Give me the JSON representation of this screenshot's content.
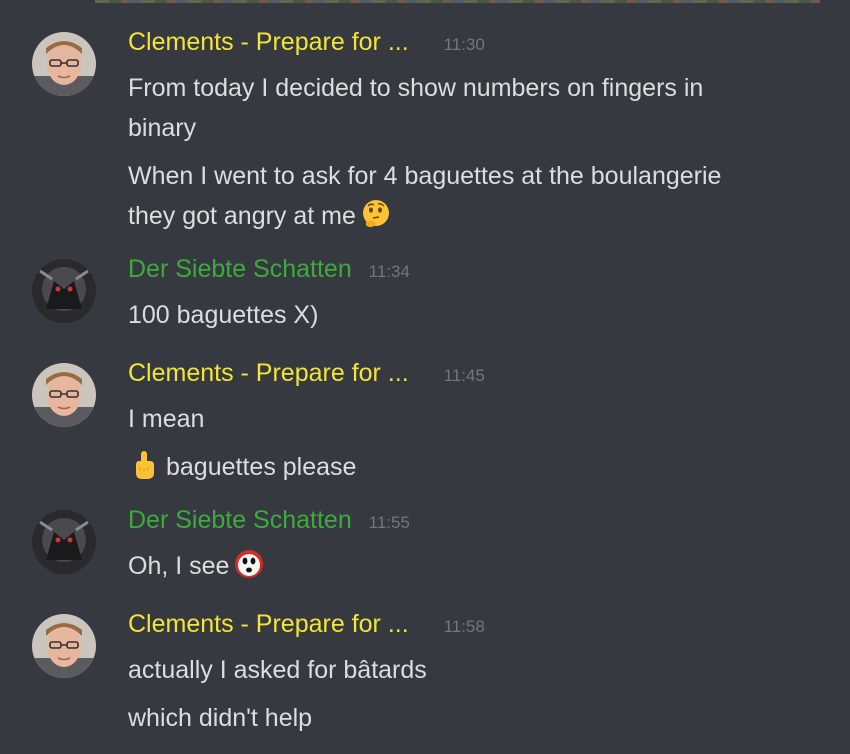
{
  "colors": {
    "background": "#36393f",
    "text": "#dcddde",
    "timestamp": "#72767d",
    "clements_name": "#f1e537",
    "siebte_name": "#3eaa3e"
  },
  "messages": [
    {
      "author": "Clements - Prepare for ...",
      "time": "11:30",
      "lines": [
        "From today I decided to show numbers on fingers in binary",
        "When I went to ask for 4 baguettes at the boulangerie they got angry at me"
      ],
      "emoji": "thinking-face"
    },
    {
      "author": "Der Siebte Schatten",
      "time": "11:34",
      "lines": [
        "100 baguettes X)"
      ]
    },
    {
      "author": "Clements - Prepare for ...",
      "time": "11:45",
      "lines": [
        "I mean",
        "baguettes please"
      ],
      "emoji": "middle-finger"
    },
    {
      "author": "Der Siebte Schatten",
      "time": "11:55",
      "lines": [
        "Oh, I see"
      ],
      "emoji": "shy-guy-mask"
    },
    {
      "author": "Clements - Prepare for ...",
      "time": "11:58",
      "lines": [
        "actually I asked for bâtards",
        "which didn't help"
      ]
    }
  ]
}
